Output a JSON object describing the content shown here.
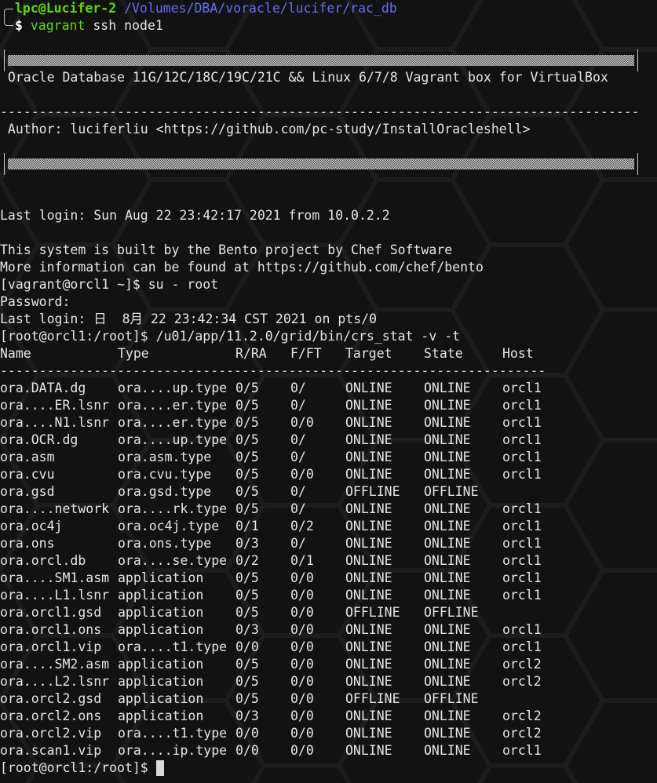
{
  "prompt": {
    "user_host": "lpc@Lucifer-2",
    "path": "/Volumes/DBA/voracle/lucifer/rac_db",
    "dollar": "$",
    "command_name": "vagrant",
    "command_args": " ssh node1"
  },
  "banner": {
    "title": " Oracle Database 11G/12C/18C/19C/21C && Linux 6/7/8 Vagrant box for VirtualBox",
    "separator": "----------------------------------------------------------------------------------",
    "author": " Author: luciferliu <https://github.com/pc-study/InstallOracleshell>"
  },
  "session": {
    "last_login_1": "Last login: Sun Aug 22 23:42:17 2021 from 10.0.2.2",
    "bento_line_1": "This system is built by the Bento project by Chef Software",
    "bento_line_2": "More information can be found at https://github.com/chef/bento",
    "su_command": "[vagrant@orcl1 ~]$ su - root",
    "password_prompt": "Password:",
    "last_login_2": "Last login: 日  8月 22 23:42:34 CST 2021 on pts/0",
    "crs_command": "[root@orcl1:/root]$ /u01/app/11.2.0/grid/bin/crs_stat -v -t",
    "final_prompt": "[root@orcl1:/root]$ "
  },
  "crs_table": {
    "headers": [
      "Name",
      "Type",
      "R/RA",
      "F/FT",
      "Target",
      "State",
      "Host"
    ],
    "separator": "----------------------------------------------------------------------",
    "rows": [
      [
        "ora.DATA.dg",
        "ora....up.type",
        "0/5",
        "0/",
        "ONLINE",
        "ONLINE",
        "orcl1"
      ],
      [
        "ora....ER.lsnr",
        "ora....er.type",
        "0/5",
        "0/",
        "ONLINE",
        "ONLINE",
        "orcl1"
      ],
      [
        "ora....N1.lsnr",
        "ora....er.type",
        "0/5",
        "0/0",
        "ONLINE",
        "ONLINE",
        "orcl1"
      ],
      [
        "ora.OCR.dg",
        "ora....up.type",
        "0/5",
        "0/",
        "ONLINE",
        "ONLINE",
        "orcl1"
      ],
      [
        "ora.asm",
        "ora.asm.type",
        "0/5",
        "0/",
        "ONLINE",
        "ONLINE",
        "orcl1"
      ],
      [
        "ora.cvu",
        "ora.cvu.type",
        "0/5",
        "0/0",
        "ONLINE",
        "ONLINE",
        "orcl1"
      ],
      [
        "ora.gsd",
        "ora.gsd.type",
        "0/5",
        "0/",
        "OFFLINE",
        "OFFLINE",
        ""
      ],
      [
        "ora....network",
        "ora....rk.type",
        "0/5",
        "0/",
        "ONLINE",
        "ONLINE",
        "orcl1"
      ],
      [
        "ora.oc4j",
        "ora.oc4j.type",
        "0/1",
        "0/2",
        "ONLINE",
        "ONLINE",
        "orcl1"
      ],
      [
        "ora.ons",
        "ora.ons.type",
        "0/3",
        "0/",
        "ONLINE",
        "ONLINE",
        "orcl1"
      ],
      [
        "ora.orcl.db",
        "ora....se.type",
        "0/2",
        "0/1",
        "ONLINE",
        "ONLINE",
        "orcl1"
      ],
      [
        "ora....SM1.asm",
        "application",
        "0/5",
        "0/0",
        "ONLINE",
        "ONLINE",
        "orcl1"
      ],
      [
        "ora....L1.lsnr",
        "application",
        "0/5",
        "0/0",
        "ONLINE",
        "ONLINE",
        "orcl1"
      ],
      [
        "ora.orcl1.gsd",
        "application",
        "0/5",
        "0/0",
        "OFFLINE",
        "OFFLINE",
        ""
      ],
      [
        "ora.orcl1.ons",
        "application",
        "0/3",
        "0/0",
        "ONLINE",
        "ONLINE",
        "orcl1"
      ],
      [
        "ora.orcl1.vip",
        "ora....t1.type",
        "0/0",
        "0/0",
        "ONLINE",
        "ONLINE",
        "orcl1"
      ],
      [
        "ora....SM2.asm",
        "application",
        "0/5",
        "0/0",
        "ONLINE",
        "ONLINE",
        "orcl2"
      ],
      [
        "ora....L2.lsnr",
        "application",
        "0/5",
        "0/0",
        "ONLINE",
        "ONLINE",
        "orcl2"
      ],
      [
        "ora.orcl2.gsd",
        "application",
        "0/5",
        "0/0",
        "OFFLINE",
        "OFFLINE",
        ""
      ],
      [
        "ora.orcl2.ons",
        "application",
        "0/3",
        "0/0",
        "ONLINE",
        "ONLINE",
        "orcl2"
      ],
      [
        "ora.orcl2.vip",
        "ora....t1.type",
        "0/0",
        "0/0",
        "ONLINE",
        "ONLINE",
        "orcl2"
      ],
      [
        "ora.scan1.vip",
        "ora....ip.type",
        "0/0",
        "0/0",
        "ONLINE",
        "ONLINE",
        "orcl1"
      ]
    ]
  },
  "colors": {
    "background": "#121212",
    "text": "#e6e6e6",
    "prompt_user": "#5fd700",
    "prompt_path": "#6b6bff",
    "hex_pattern": "#1c1c1c"
  }
}
